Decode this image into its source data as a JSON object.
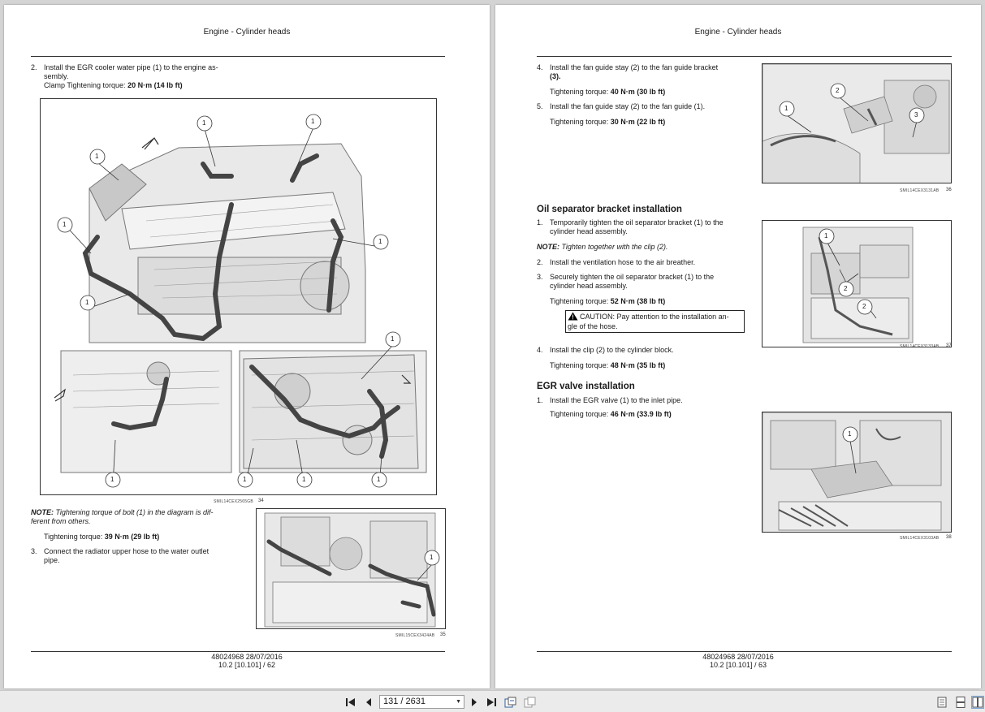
{
  "left_page": {
    "header": "Engine - Cylinder heads",
    "step2_num": "2.",
    "step2_line1": "Install the EGR cooler water pipe (1) to the engine as-",
    "step2_line2": "sembly.",
    "step2_torque_label": "Clamp Tightening torque: ",
    "step2_torque_value": "20 N·m (14 lb ft)",
    "fig34_code": "SMIL14CEX2565GB",
    "fig34_num": "34",
    "fig34_callout": "1",
    "note_label": "NOTE:",
    "note_text": " Tightening torque of bolt (1) in the diagram is dif-",
    "note_text2": "ferent from others.",
    "note_torque_label": "Tightening torque: ",
    "note_torque_value": "39 N·m (29 lb ft)",
    "step3_num": "3.",
    "step3_line1": "Connect the radiator upper hose to the water outlet",
    "step3_line2": "pipe.",
    "fig35_code": "SMIL15CEX3424AB",
    "fig35_num": "35",
    "footer_doc": "48024968 28/07/2016",
    "footer_page": "10.2 [10.101] / 62"
  },
  "right_page": {
    "header": "Engine - Cylinder heads",
    "step4_num": "4.",
    "step4_line1": "Install the fan guide stay (2) to the fan guide bracket",
    "step4_line2": "(3).",
    "step4_torque_label": "Tightening torque: ",
    "step4_torque_value": "40 N·m (30 lb ft)",
    "step5_num": "5.",
    "step5_line1": "Install the fan guide stay (2) to the fan guide (1).",
    "step5_torque_label": "Tightening torque: ",
    "step5_torque_value": "30 N·m (22 lb ft)",
    "fig36_code": "SMIL14CEX3131AB",
    "fig36_num": "36",
    "oil_title": "Oil separator bracket installation",
    "oil1_num": "1.",
    "oil1_line1": "Temporarily tighten the oil separator bracket (1) to the",
    "oil1_line2": "cylinder head assembly.",
    "oil_note_label": "NOTE:",
    "oil_note_text": " Tighten together with the clip (2).",
    "oil2_num": "2.",
    "oil2_line1": "Install the ventilation hose to the air breather.",
    "oil3_num": "3.",
    "oil3_line1": "Securely tighten the oil separator bracket (1) to the",
    "oil3_line2": "cylinder head assembly.",
    "oil3_torque_label": "Tightening torque: ",
    "oil3_torque_value": "52 N·m (38 lb ft)",
    "caution_line1": "CAUTION: Pay attention to the installation an-",
    "caution_line2": "gle of the hose.",
    "oil4_num": "4.",
    "oil4_line1": "Install the clip (2) to the cylinder block.",
    "oil4_torque_label": "Tightening torque: ",
    "oil4_torque_value": "48 N·m (35 lb ft)",
    "fig37_code": "SMIL14CEX3133AB",
    "fig37_num": "37",
    "egr_title": "EGR valve installation",
    "egr1_num": "1.",
    "egr1_line1": "Install the EGR valve (1) to the inlet pipe.",
    "egr1_torque_label": "Tightening torque: ",
    "egr1_torque_value": "46 N·m (33.9 lb ft)",
    "fig38_code": "SMIL14CEX3103AB",
    "fig38_num": "38",
    "footer_doc": "48024968 28/07/2016",
    "footer_page": "10.2 [10.101] / 63"
  },
  "callouts": {
    "c1": "1",
    "c2": "2",
    "c3": "3"
  },
  "toolbar": {
    "page_field": "131 / 2631",
    "icons": [
      "first-page-icon",
      "prev-page-icon",
      "next-page-icon",
      "last-page-icon",
      "fit-page-icon",
      "fit-width-icon",
      "single-page-view-icon",
      "continuous-view-icon",
      "two-page-view-icon"
    ]
  }
}
